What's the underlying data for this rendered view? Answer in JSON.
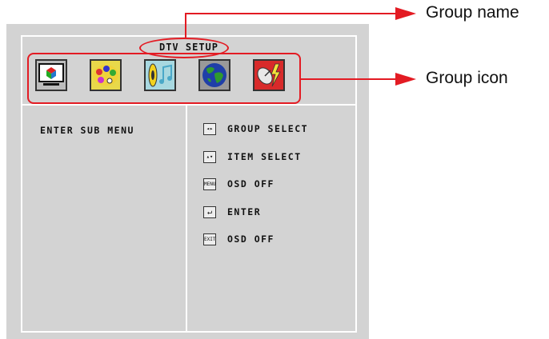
{
  "osd": {
    "title": "DTV SETUP",
    "icons": [
      {
        "name": "tv-icon"
      },
      {
        "name": "palette-icon"
      },
      {
        "name": "music-icon"
      },
      {
        "name": "globe-icon"
      },
      {
        "name": "satellite-icon"
      }
    ],
    "left_text": "ENTER SUB MENU",
    "help": [
      {
        "key": "◂▸",
        "label": "GROUP SELECT",
        "icon": "left-right-arrows-icon"
      },
      {
        "key": "▴▾",
        "label": "ITEM SELECT",
        "icon": "up-down-arrows-icon"
      },
      {
        "key": "MENU",
        "label": "OSD OFF",
        "icon": "menu-key-icon"
      },
      {
        "key": "↵",
        "label": "ENTER",
        "icon": "enter-key-icon"
      },
      {
        "key": "EXIT",
        "label": "OSD OFF",
        "icon": "exit-key-icon"
      }
    ]
  },
  "annotations": {
    "group_name": "Group name",
    "group_icon": "Group icon",
    "accent": "#e31b23"
  }
}
